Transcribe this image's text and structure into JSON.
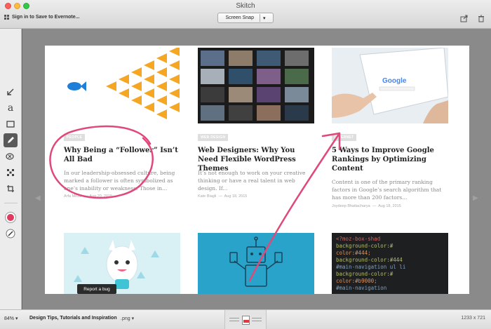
{
  "window": {
    "title": "Skitch"
  },
  "header": {
    "signin_label": "Sign in to Save to Evernote...",
    "snap_label": "Screen Snap",
    "snap_arrow": "▾"
  },
  "toolbar": {
    "tools": [
      "arrow",
      "text",
      "rectangle",
      "pen",
      "pixelate",
      "stamp",
      "crop"
    ],
    "selected_tool": "pen",
    "color": "#e03a5f"
  },
  "cards": [
    {
      "tag": "PEOPLE",
      "title": "Why Being a “Follower” Isn’t All Bad",
      "excerpt": "In our leadership-obsessed culture, being marked a follower is often symbolized as one’s inability or weakness. Those in...",
      "author": "Arfa Mirza",
      "date": "Aug 20, 2015"
    },
    {
      "tag": "WEB DESIGN",
      "title": "Web Designers: Why You Need Flexible WordPress Themes",
      "excerpt": "It’s not enough to work on your creative thinking or have a real talent in web design. If...",
      "author": "Kate Biagli",
      "date": "Aug 18, 2015"
    },
    {
      "tag": "INTERNET",
      "title": "5 Ways to Improve Google Rankings by Optimizing Content",
      "excerpt": "Content is one of the primary ranking factors in Google’s search algorithm that has more than 200 factors...",
      "author": "Joydeep Bhattacharya",
      "date": "Aug 18, 2015"
    }
  ],
  "meta_separator": "—",
  "google_word": "Google",
  "code_lines": [
    "<?moz-box-shad",
    "background-color:#",
    "color:#444;",
    "background-color:#444",
    "#main-navigation ul li",
    "background-color:#",
    "color:#b9000;",
    "#main-navigation"
  ],
  "report_bug_label": "Report a bug",
  "status": {
    "zoom": "84%",
    "zoom_arrow": "▾",
    "filename": "Design Tips, Tutorials and Inspiration",
    "extension": ".png",
    "extension_arrow": "▾",
    "dimensions": "1233 x 721"
  },
  "colors": {
    "annotation": "#e0487a",
    "accent_orange": "#f5a623",
    "fish_blue": "#1e7fd8"
  }
}
